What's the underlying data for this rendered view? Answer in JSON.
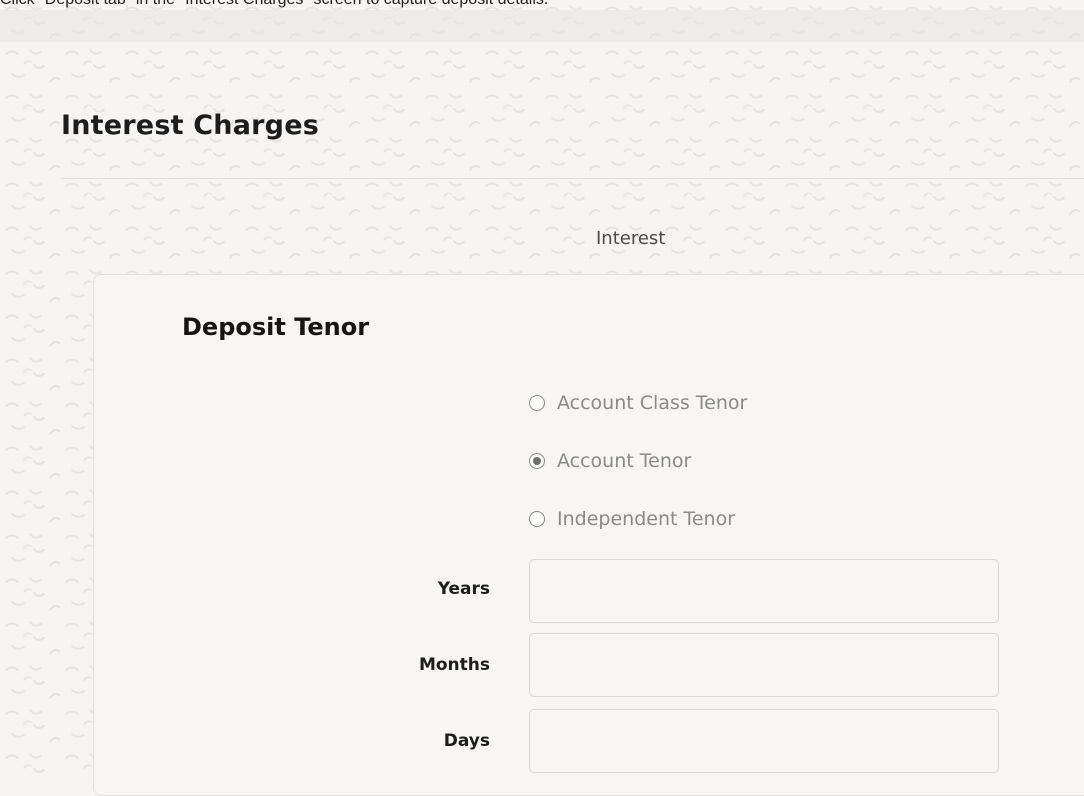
{
  "caption": "Click \"Deposit tab\" in the \"Interest Charges\" screen to capture deposit details.",
  "page": {
    "title": "Interest Charges"
  },
  "tab": {
    "label": "Interest"
  },
  "section": {
    "title": "Deposit Tenor"
  },
  "tenor_options": [
    {
      "label": "Account Class Tenor",
      "selected": false
    },
    {
      "label": "Account Tenor",
      "selected": true
    },
    {
      "label": "Independent Tenor",
      "selected": false
    }
  ],
  "fields": {
    "years": {
      "label": "Years",
      "value": ""
    },
    "months": {
      "label": "Months",
      "value": ""
    },
    "days": {
      "label": "Days",
      "value": ""
    }
  },
  "colors": {
    "background": "#f6f5f3",
    "panel": "#f7f6f4",
    "radio_disabled": "#8a8a8a"
  }
}
